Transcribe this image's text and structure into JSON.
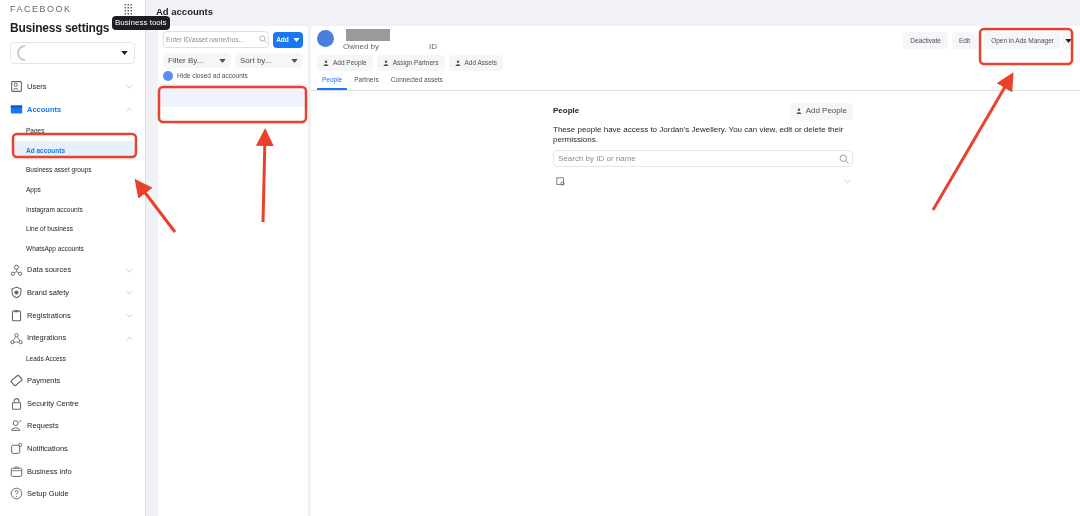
{
  "sidebar": {
    "brand": "FACEBOOK",
    "title": "Business settings",
    "tooltip": "Business tools",
    "items": [
      {
        "label": "Users",
        "expanded": false,
        "selected": false
      },
      {
        "label": "Accounts",
        "expanded": true,
        "selected": true,
        "children": [
          {
            "label": "Pages",
            "selected": false
          },
          {
            "label": "Ad accounts",
            "selected": true
          },
          {
            "label": "Business asset groups",
            "selected": false
          },
          {
            "label": "Apps",
            "selected": false
          },
          {
            "label": "Instagram accounts",
            "selected": false
          },
          {
            "label": "Line of business",
            "selected": false
          },
          {
            "label": "WhatsApp accounts",
            "selected": false
          }
        ]
      },
      {
        "label": "Data sources",
        "expanded": false,
        "selected": false
      },
      {
        "label": "Brand safety",
        "expanded": false,
        "selected": false
      },
      {
        "label": "Registrations",
        "expanded": false,
        "selected": false
      },
      {
        "label": "Integrations",
        "expanded": true,
        "selected": false,
        "children": [
          {
            "label": "Leads Access",
            "selected": false
          }
        ]
      },
      {
        "label": "Payments",
        "selected": false
      },
      {
        "label": "Security Centre",
        "selected": false
      },
      {
        "label": "Requests",
        "selected": false
      },
      {
        "label": "Notifications",
        "selected": false
      },
      {
        "label": "Business info",
        "selected": false
      },
      {
        "label": "Setup Guide",
        "selected": false
      }
    ]
  },
  "page_title": "Ad accounts",
  "list_panel": {
    "search": {
      "placeholder": "Enter ID/asset name/bus..."
    },
    "add_button": "Add",
    "filter": "Filter By...",
    "sort": "Sort by...",
    "toggle": {
      "label": "Hide closed ad accounts",
      "on": true
    },
    "rows": [
      {
        "selected": true
      }
    ]
  },
  "detail": {
    "owned_by": "Owned by",
    "id_label": "ID",
    "actions": [
      "Add People",
      "Assign Partners",
      "Add Assets"
    ],
    "top_buttons": [
      "Deactivate",
      "Edit",
      "Open in Ads Manager"
    ],
    "tabs": [
      {
        "label": "People",
        "selected": true
      },
      {
        "label": "Partners",
        "selected": false
      },
      {
        "label": "Connected assets",
        "selected": false
      }
    ],
    "people": {
      "title": "People",
      "add_button": "Add People",
      "description": "These people have access to Jordan's Jewellery. You can view, edit or delete their permissions.",
      "search": {
        "placeholder": "Search by ID or name"
      }
    }
  }
}
